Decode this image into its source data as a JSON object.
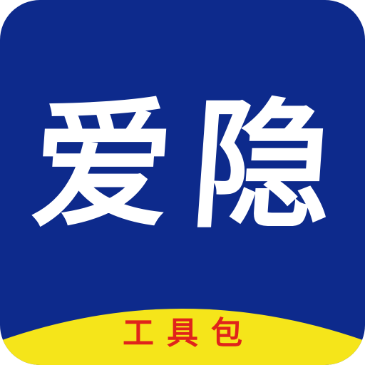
{
  "app_icon": {
    "title": "爱隐",
    "title_chars": [
      "爱",
      "隐"
    ],
    "subtitle": "工具包",
    "colors": {
      "background": "#0d2a8c",
      "title_text": "#ffffff",
      "banner": "#f5e51a",
      "subtitle_text": "#e0231b"
    }
  }
}
